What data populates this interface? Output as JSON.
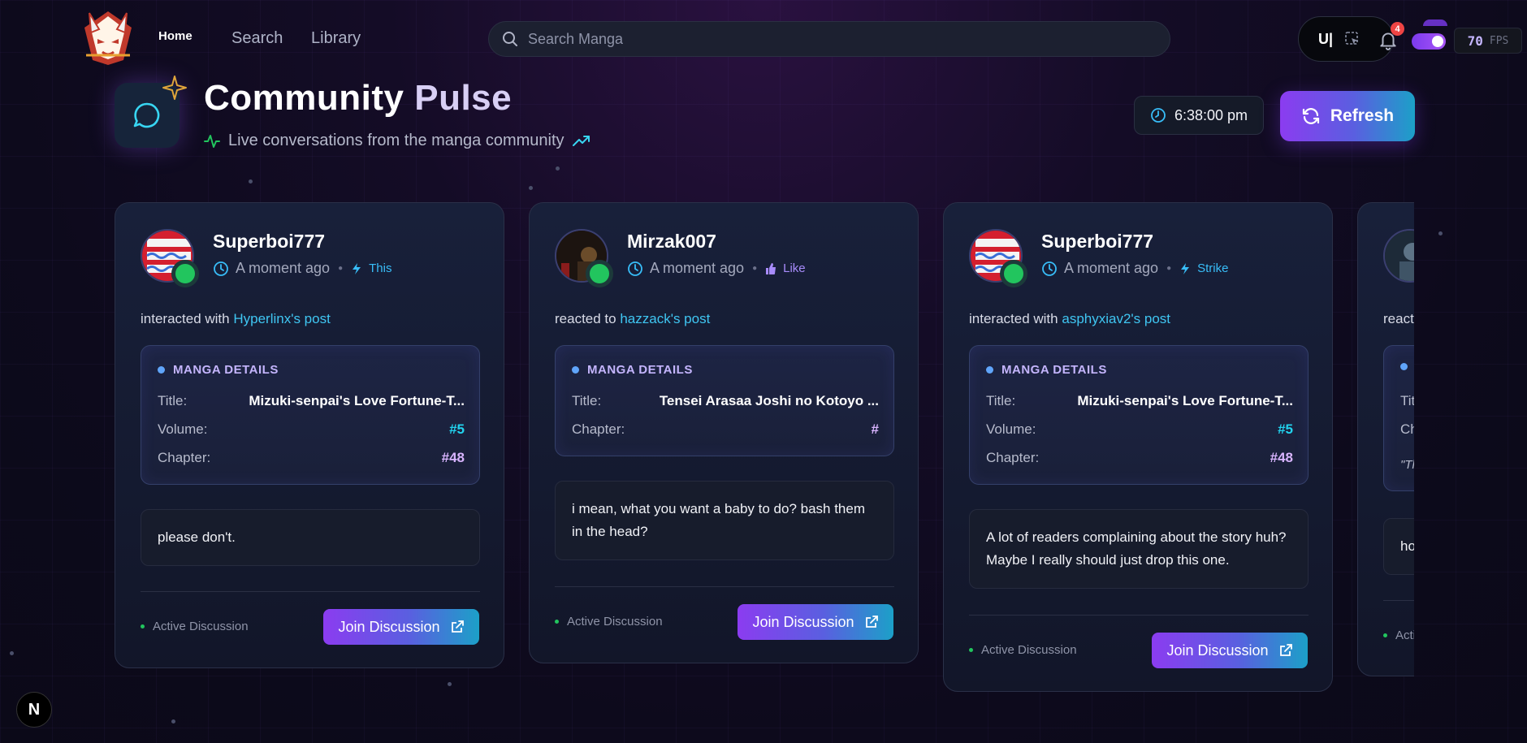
{
  "nav": {
    "links": [
      {
        "label": "Home",
        "active": true
      },
      {
        "label": "Search",
        "active": false
      },
      {
        "label": "Library",
        "active": false
      }
    ],
    "search_placeholder": "Search Manga",
    "tool_label": "U|",
    "notification_count": "4",
    "fps_value": "70",
    "fps_label": "FPS"
  },
  "header": {
    "title_main": "Community",
    "title_accent": "Pulse",
    "subtitle": "Live conversations from the manga community",
    "time": "6:38:00 pm",
    "refresh_label": "Refresh"
  },
  "cards": [
    {
      "user": "Superboi777",
      "time": "A moment ago",
      "reaction": "This",
      "action_text": "interacted with",
      "target": "Hyperlinx's post",
      "details_title": "MANGA DETAILS",
      "title_label": "Title:",
      "title": "Mizuki-senpai's Love Fortune-T...",
      "volume_label": "Volume:",
      "volume": "#5",
      "chapter_label": "Chapter:",
      "chapter": "#48",
      "comment": "please don't.",
      "status": "Active Discussion",
      "join_label": "Join Discussion"
    },
    {
      "user": "Mirzak007",
      "time": "A moment ago",
      "reaction": "Like",
      "action_text": "reacted to",
      "target": "hazzack's post",
      "details_title": "MANGA DETAILS",
      "title_label": "Title:",
      "title": "Tensei Arasaa Joshi no Kotoyo ...",
      "chapter_label": "Chapter:",
      "chapter": "#",
      "comment": "i mean, what you want a baby to do? bash them in the head?",
      "status": "Active Discussion",
      "join_label": "Join Discussion"
    },
    {
      "user": "Superboi777",
      "time": "A moment ago",
      "reaction": "Strike",
      "action_text": "interacted with",
      "target": "asphyxiav2's post",
      "details_title": "MANGA DETAILS",
      "title_label": "Title:",
      "title": "Mizuki-senpai's Love Fortune-T...",
      "volume_label": "Volume:",
      "volume": "#5",
      "chapter_label": "Chapter:",
      "chapter": "#48",
      "comment": "A lot of readers complaining about the story huh? Maybe I really should just drop this one.",
      "status": "Active Discussion",
      "join_label": "Join Discussion"
    },
    {
      "action_text": "react",
      "title_label": "Titl",
      "chapter_label": "Ch",
      "quote_snippet": "\"Th",
      "comment": "ho",
      "status": "Acti"
    }
  ],
  "dev_badge": "N",
  "colors": {
    "accent_purple": "#8b3cf0",
    "accent_cyan": "#1ca0c8",
    "online_green": "#22c55e",
    "link_cyan": "#3fc6f2"
  }
}
